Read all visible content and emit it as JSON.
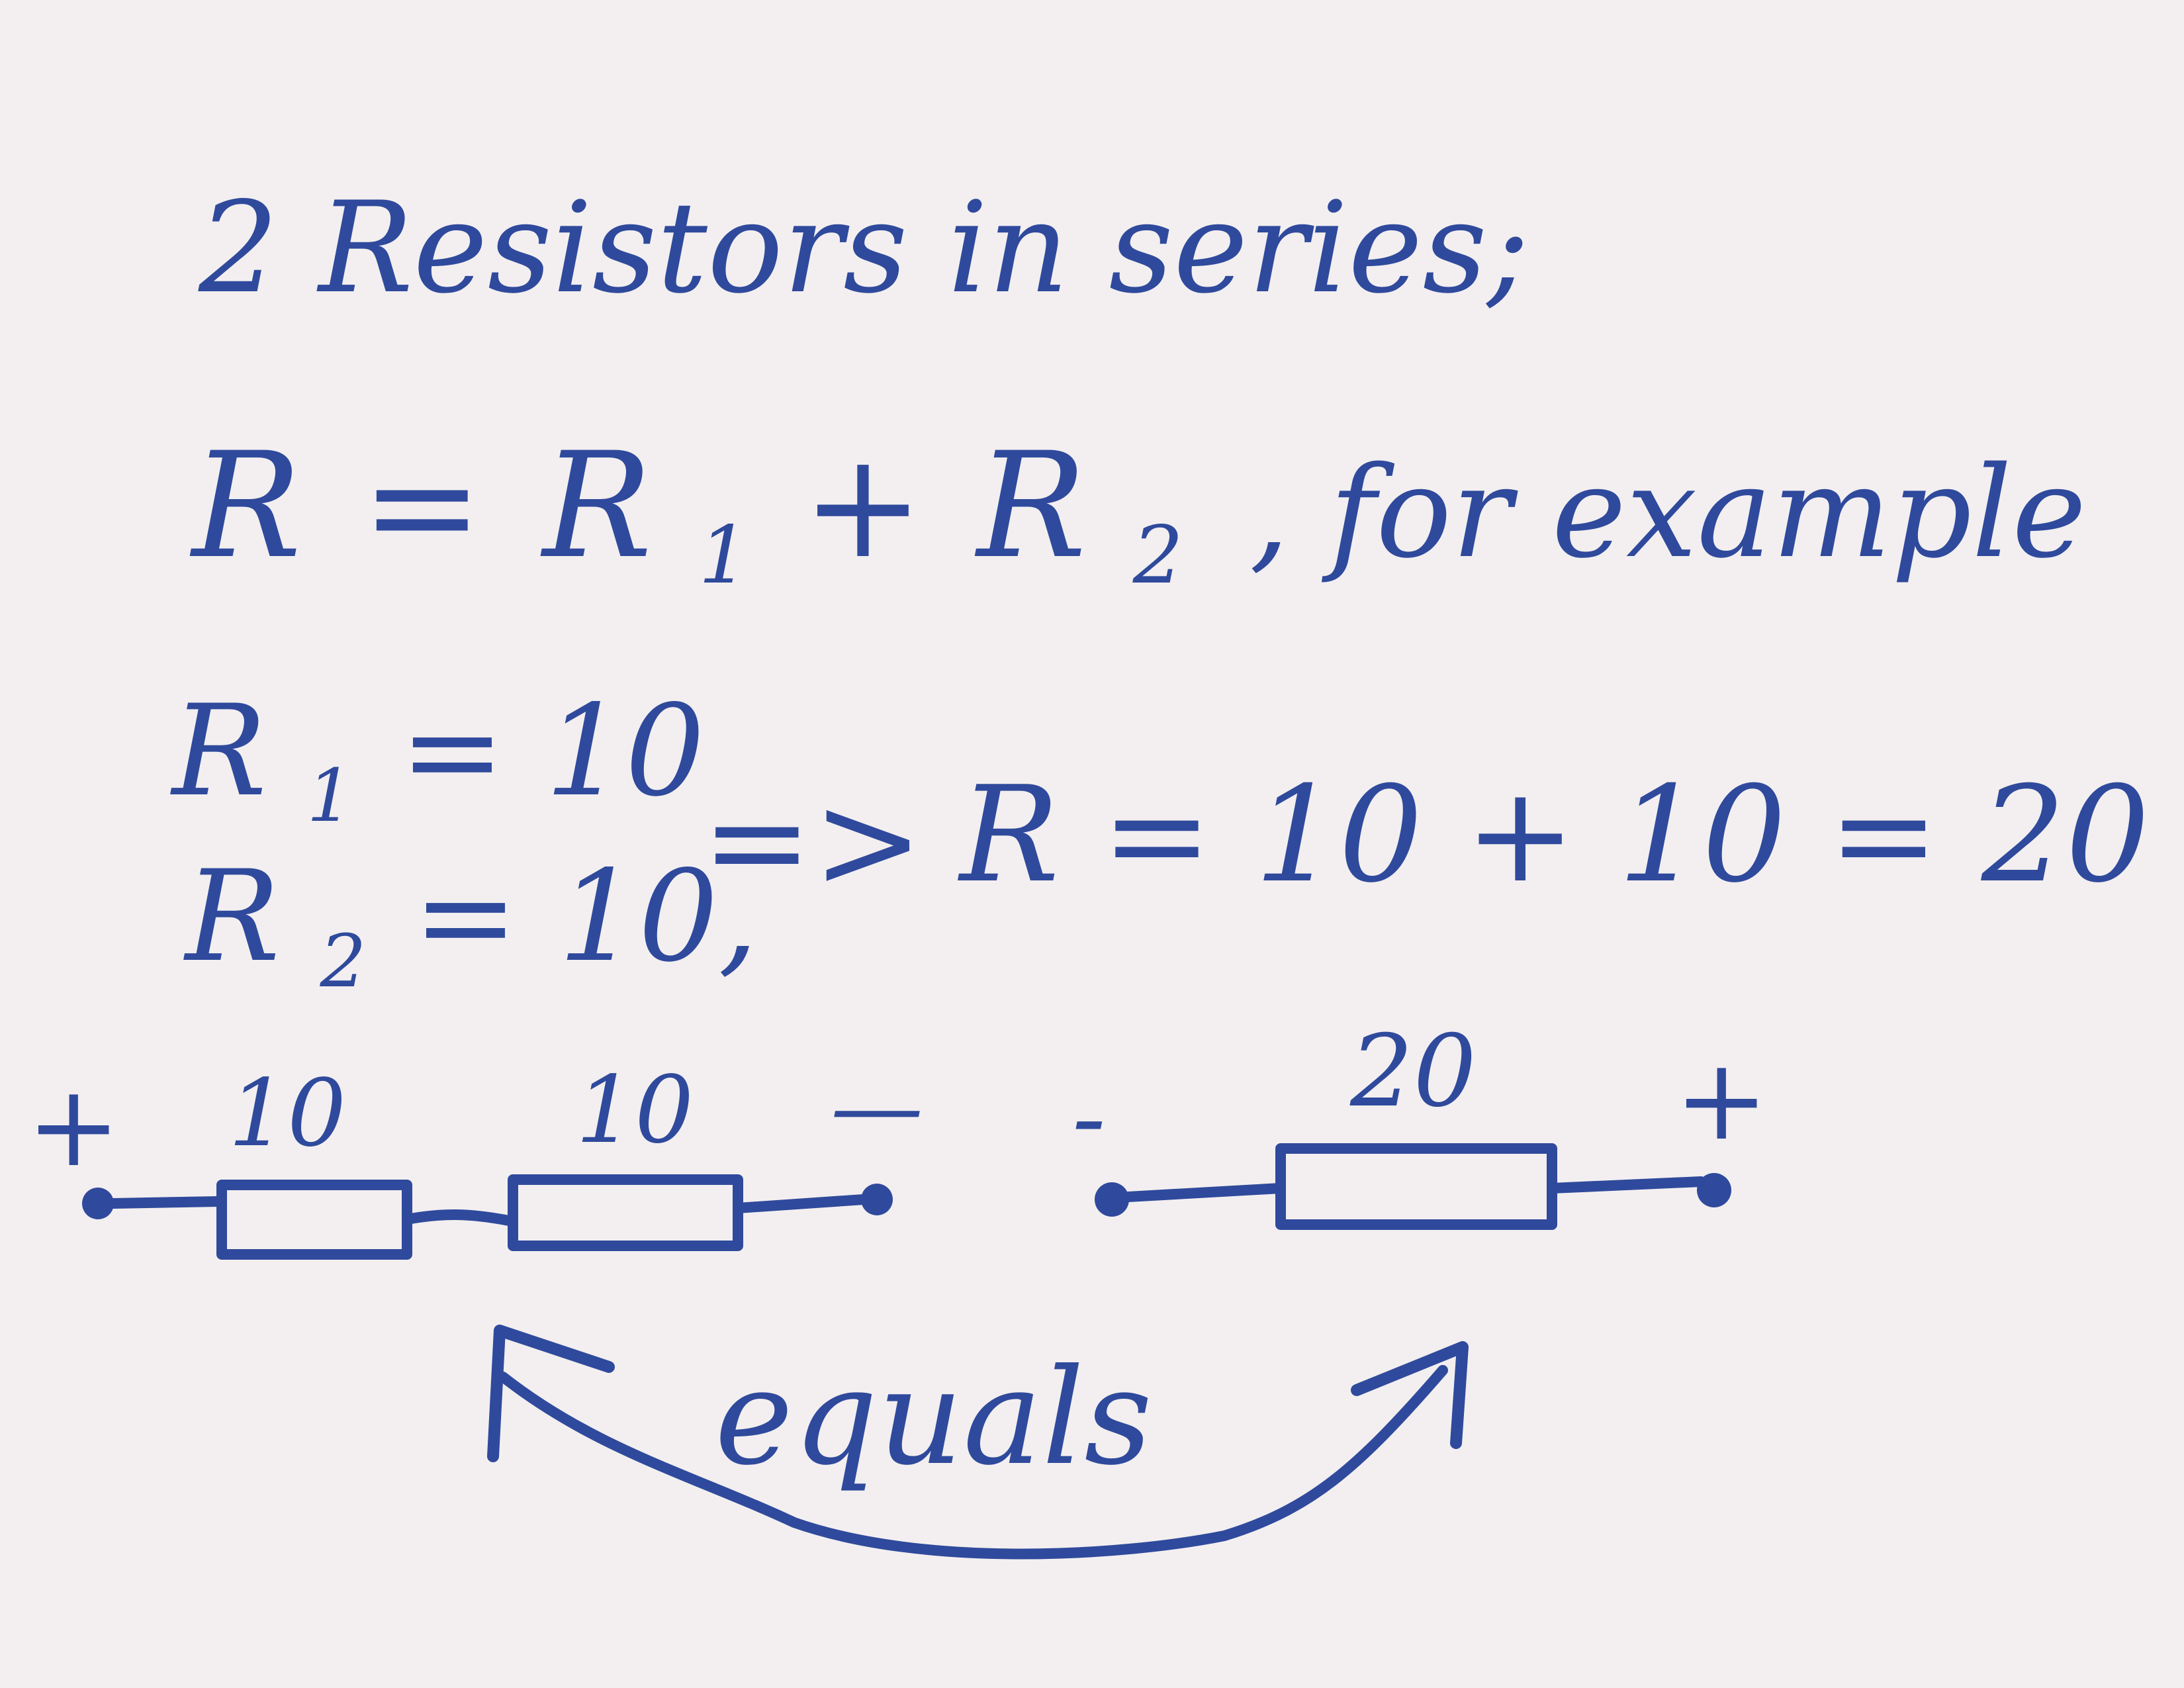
{
  "note": {
    "title": "2 Resistors in series;",
    "formula": {
      "lhs": "R",
      "eq": "=",
      "r1": "R",
      "r1_sub": "1",
      "plus": "+",
      "r2": "R",
      "r2_sub": "2",
      "tail": ", for example"
    },
    "given": {
      "r1": {
        "symbol": "R",
        "sub": "1",
        "rest": "= 10"
      },
      "r2": {
        "symbol": "R",
        "sub": "2",
        "rest": "= 10,"
      }
    },
    "implies": "=>",
    "result": "R = 10 + 10 = 20",
    "equals_label": "equals"
  },
  "circuit_series": {
    "plus_sign": "+",
    "minus_sign": "—",
    "resistors": [
      {
        "value": "10"
      },
      {
        "value": "10"
      }
    ]
  },
  "circuit_equivalent": {
    "minus_sign": "-",
    "plus_sign": "+",
    "resistor": {
      "value": "20"
    }
  },
  "colors": {
    "ink": "#2f4a9c",
    "paper": "#f3eff0"
  }
}
